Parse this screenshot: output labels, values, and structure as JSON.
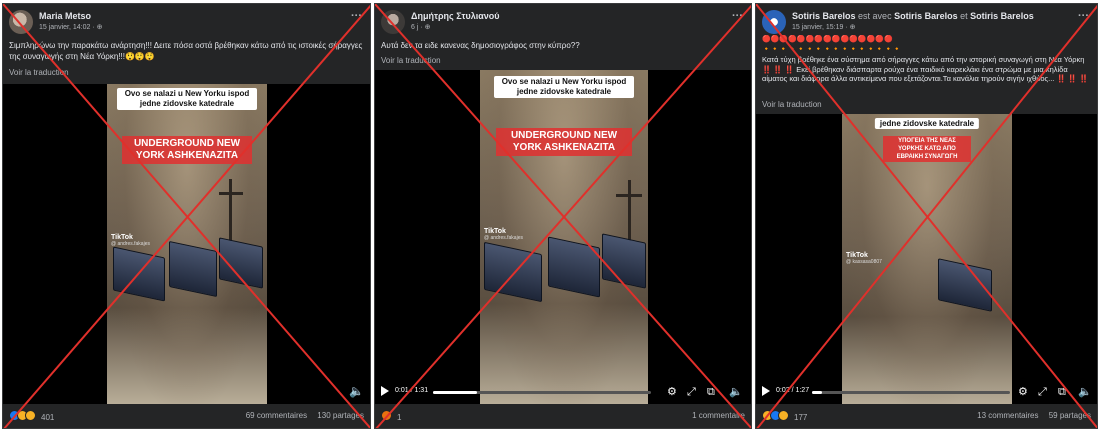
{
  "colors": {
    "cross": "#e0302b",
    "panel_bg": "#242526",
    "caption_red": "#e03030"
  },
  "posts": [
    {
      "author": "Maria Metso",
      "date": "15 janvier, 14:02 · ⊕",
      "more": "···",
      "text": "Σιμπληρώνω την παρακάτω ανάρτηση!!! Δειτε πόσα οστά βρέθηκαν κάτω από τις ιστοικές σήραγγες της συναγωγής στη Νέα Υόρκη!!!😲😲😲",
      "translate": "Voir la traduction",
      "video": {
        "caption_white": "Ovo se nalazi u New Yorku ispod jedne zidovske katedrale",
        "caption_red": "UNDERGROUND NEW YORK ASHKENAZITA",
        "watermark": "TikTok",
        "watermark_user": "@ andres.fakajes"
      },
      "volume_icon": "🔈",
      "reactions": {
        "count": "401",
        "icons": [
          "like-reaction-icon",
          "haha-reaction-icon",
          "sad-reaction-icon"
        ]
      },
      "comments": "69 commentaires",
      "shares": "130 partages"
    },
    {
      "author": "Δημήτρης Στυλιανού",
      "date": "6 j · ⊕",
      "more": "···",
      "text": "Αυτά δεν τα ειδε κανενας δημοσιογράφος στην κύπρο??",
      "translate": "Voir la traduction",
      "video": {
        "caption_white": "Ovo se nalazi u New Yorku ispod jedne zidovske katedrale",
        "caption_red": "UNDERGROUND NEW YORK ASHKENAZITA",
        "watermark": "TikTok",
        "watermark_user": "@ andres.fakajes",
        "time": "0:01 / 1:31",
        "progress": 0.2
      },
      "reactions": {
        "count": "1",
        "icons": [
          "angry-reaction-icon"
        ]
      },
      "comments": "1 commentaire",
      "shares": ""
    },
    {
      "author": "Sotiris Barelos",
      "with_text": "est avec",
      "with_1": "Sotiris Barelos",
      "and_text": "et",
      "with_2": "Sotiris Barelos",
      "date": "15 janvier, 15:19 · ⊕",
      "more": "···",
      "emoji_line_1": "🔴🔴🔴🔴🔴🔴🔴🔴🔴🔴🔴🔴🔴🔴🔴",
      "emoji_line_2": "🔸🔸🔸🔸🔸🔸🔸🔸🔸🔸🔸🔸🔸🔸🔸🔸",
      "text": "Κατά τύχη βρέθηκε ένα σύστημα από σήραγγες κάτω από την ιστορική συναγωγή στη Νέα Υόρκη ‼️ ‼️ ‼️ Εκεί βρέθηκαν διάσπαρτα ρούχα ένα παιδικό καρεκλάκι ένα στρώμα με μια κηλίδα αίματος και διάφορα άλλα αντικείμενα που εξετάζονται.Τα κανάλια τηρούν σιγήν ιχθύος... ‼️ ‼️ ‼️",
      "translate": "Voir la traduction",
      "video": {
        "caption_white": "jedne zidovske katedrale",
        "caption_red": "ΥΠΟΓΕΙΑ ΤΗΣ ΝΕΑΣ ΥΟΡΚΗΣ ΚΑΤΩ ΑΠΟ ΕΒΡΑΙΚΗ ΣΥΝΑΓΩΓΗ",
        "watermark": "TikTok",
        "watermark_user": "@ kassasa0807",
        "time": "0:02 / 1:27",
        "progress": 0.05
      },
      "reactions": {
        "count": "177",
        "icons": [
          "haha-reaction-icon",
          "like-reaction-icon",
          "sad-reaction-icon"
        ]
      },
      "comments": "13 commentaires",
      "shares": "59 partages"
    }
  ]
}
